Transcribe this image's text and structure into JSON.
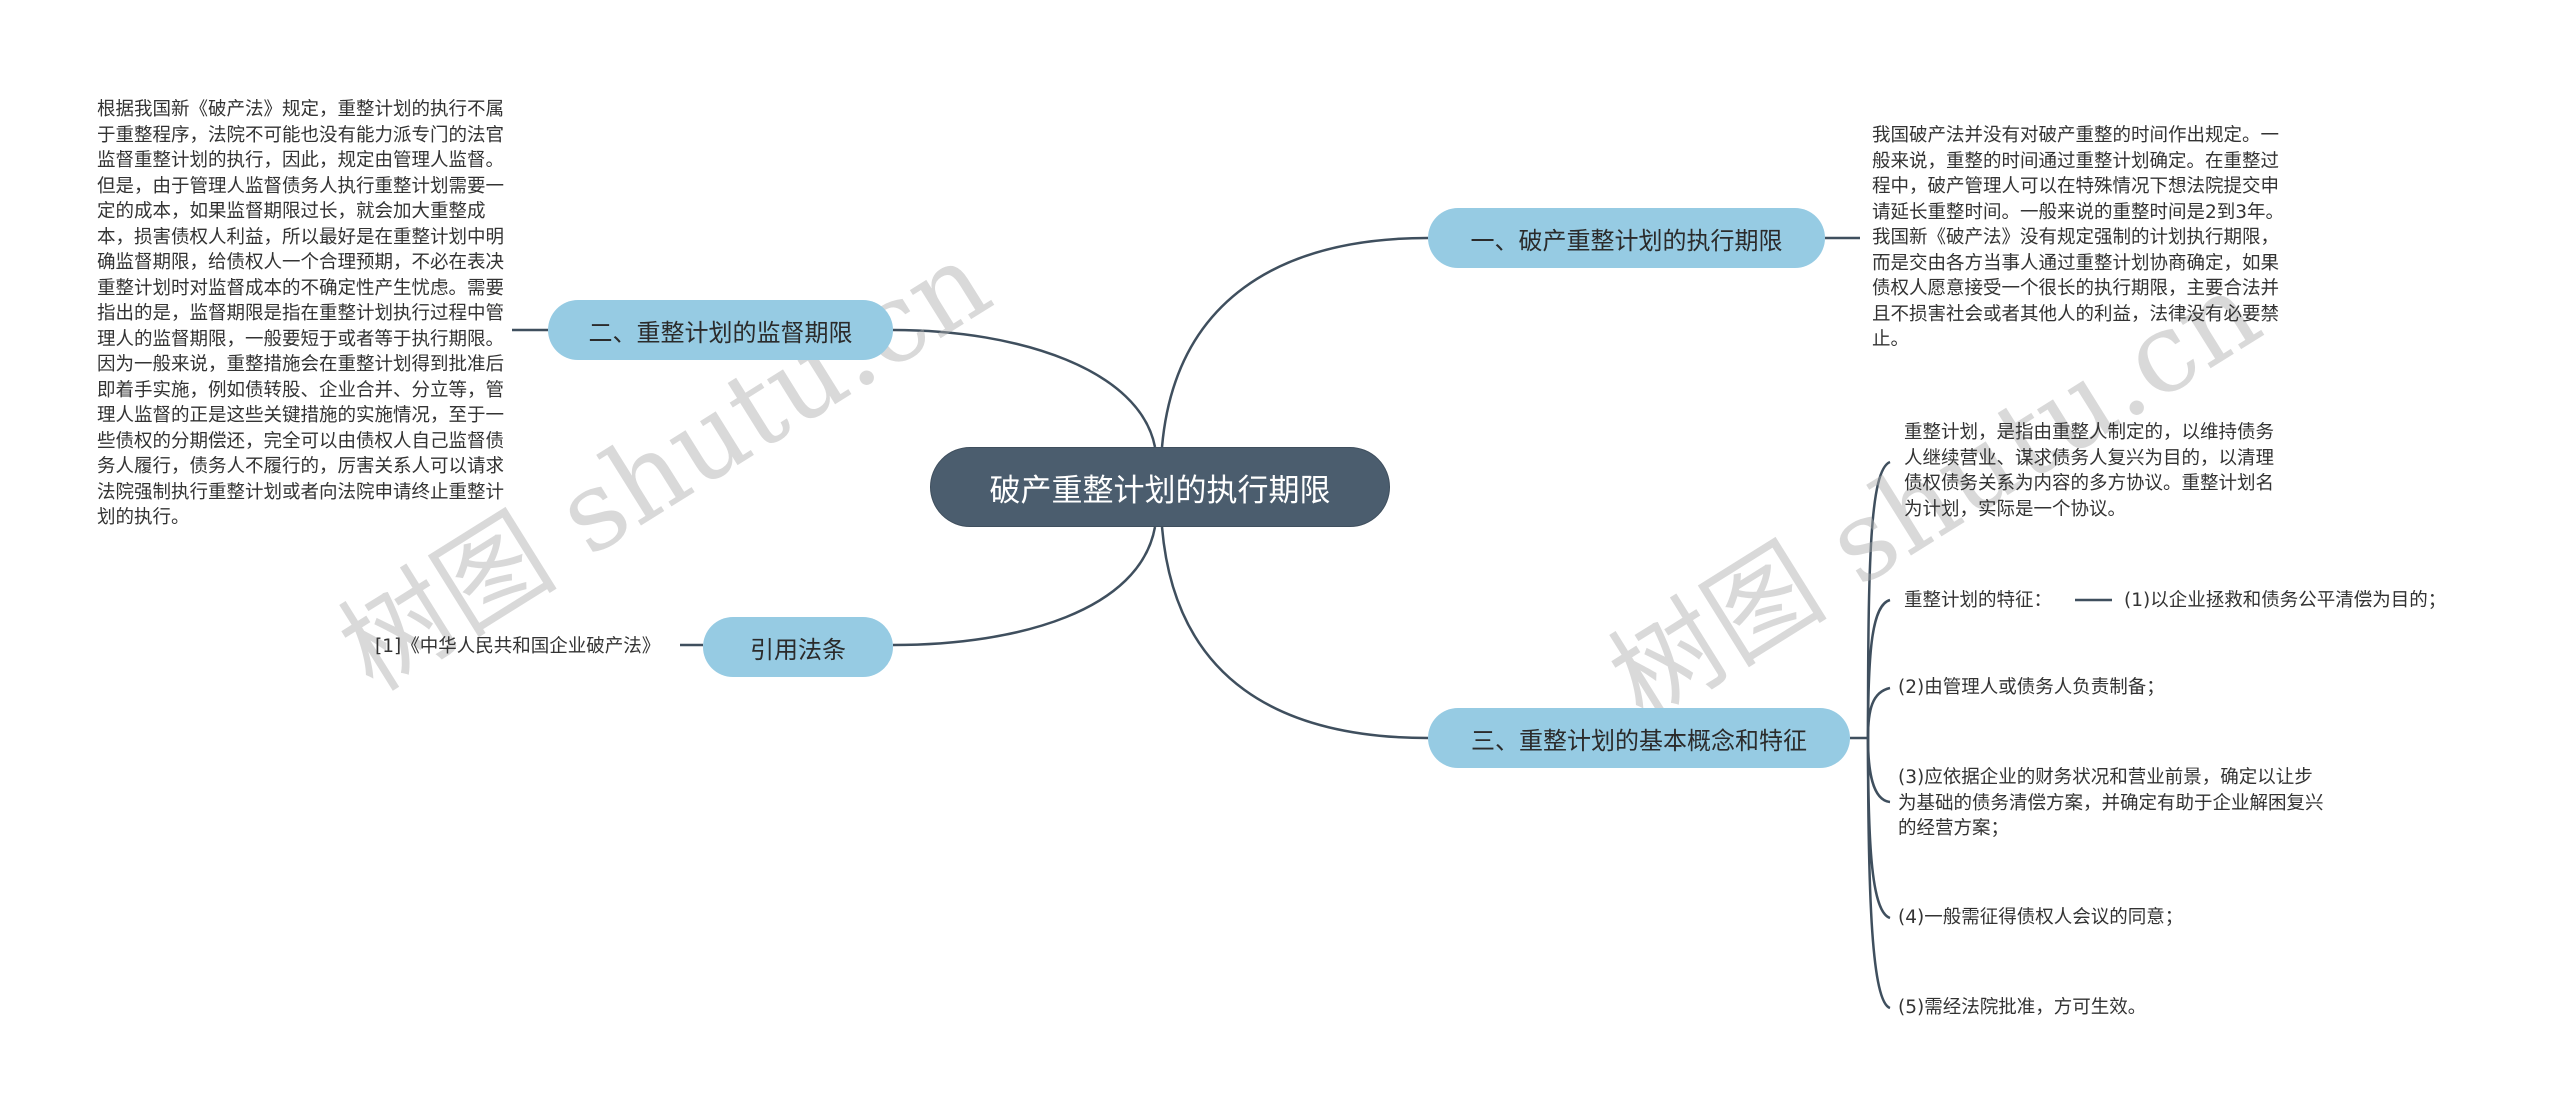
{
  "root": {
    "label": "破产重整计划的执行期限"
  },
  "branches": [
    {
      "label": "一、破产重整计划的执行期限",
      "children": [
        "我国破产法并没有对破产重整的时间作出规定。一般来说，重整的时间通过重整计划确定。在重整过程中，破产管理人可以在特殊情况下想法院提交申请延长重整时间。一般来说的重整时间是2到3年。我国新《破产法》没有规定强制的计划执行期限，而是交由各方当事人通过重整计划协商确定，如果债权人愿意接受一个很长的执行期限，主要合法并且不损害社会或者其他人的利益，法律没有必要禁止。"
      ]
    },
    {
      "label": "二、重整计划的监督期限",
      "children": [
        "根据我国新《破产法》规定，重整计划的执行不属于重整程序，法院不可能也没有能力派专门的法官监督重整计划的执行，因此，规定由管理人监督。但是，由于管理人监督债务人执行重整计划需要一定的成本，如果监督期限过长，就会加大重整成本，损害债权人利益，所以最好是在重整计划中明确监督期限，给债权人一个合理预期，不必在表决重整计划时对监督成本的不确定性产生忧虑。需要指出的是，监督期限是指在重整计划执行过程中管理人的监督期限，一般要短于或者等于执行期限。因为一般来说，重整措施会在重整计划得到批准后即着手实施，例如债转股、企业合并、分立等，管理人监督的正是这些关键措施的实施情况，至于一些债权的分期偿还，完全可以由债权人自己监督债务人履行，债务人不履行的，厉害关系人可以请求法院强制执行重整计划或者向法院申请终止重整计划的执行。"
      ]
    },
    {
      "label": "三、重整计划的基本概念和特征",
      "concept": "重整计划，是指由重整人制定的，以维持债务人继续营业、谋求债务人复兴为目的，以清理债权债务关系为内容的多方协议。重整计划名为计划，实际是一个协议。",
      "feature_label": "重整计划的特征：",
      "features": [
        "(1)以企业拯救和债务公平清偿为目的；",
        "(2)由管理人或债务人负责制备；",
        "(3)应依据企业的财务状况和营业前景，确定以让步为基础的债务清偿方案，并确定有助于企业解困复兴的经营方案；",
        "(4)一般需征得债权人会议的同意；",
        "(5)需经法院批准，方可生效。"
      ]
    },
    {
      "label": "引用法条",
      "children": [
        "[1]《中华人民共和国企业破产法》"
      ]
    }
  ],
  "watermark": "树图 shutu.cn",
  "colors": {
    "root_fill": "#4b5d6e",
    "branch_fill": "#96cbe3",
    "line": "#3f4f5e",
    "text": "#333333"
  }
}
